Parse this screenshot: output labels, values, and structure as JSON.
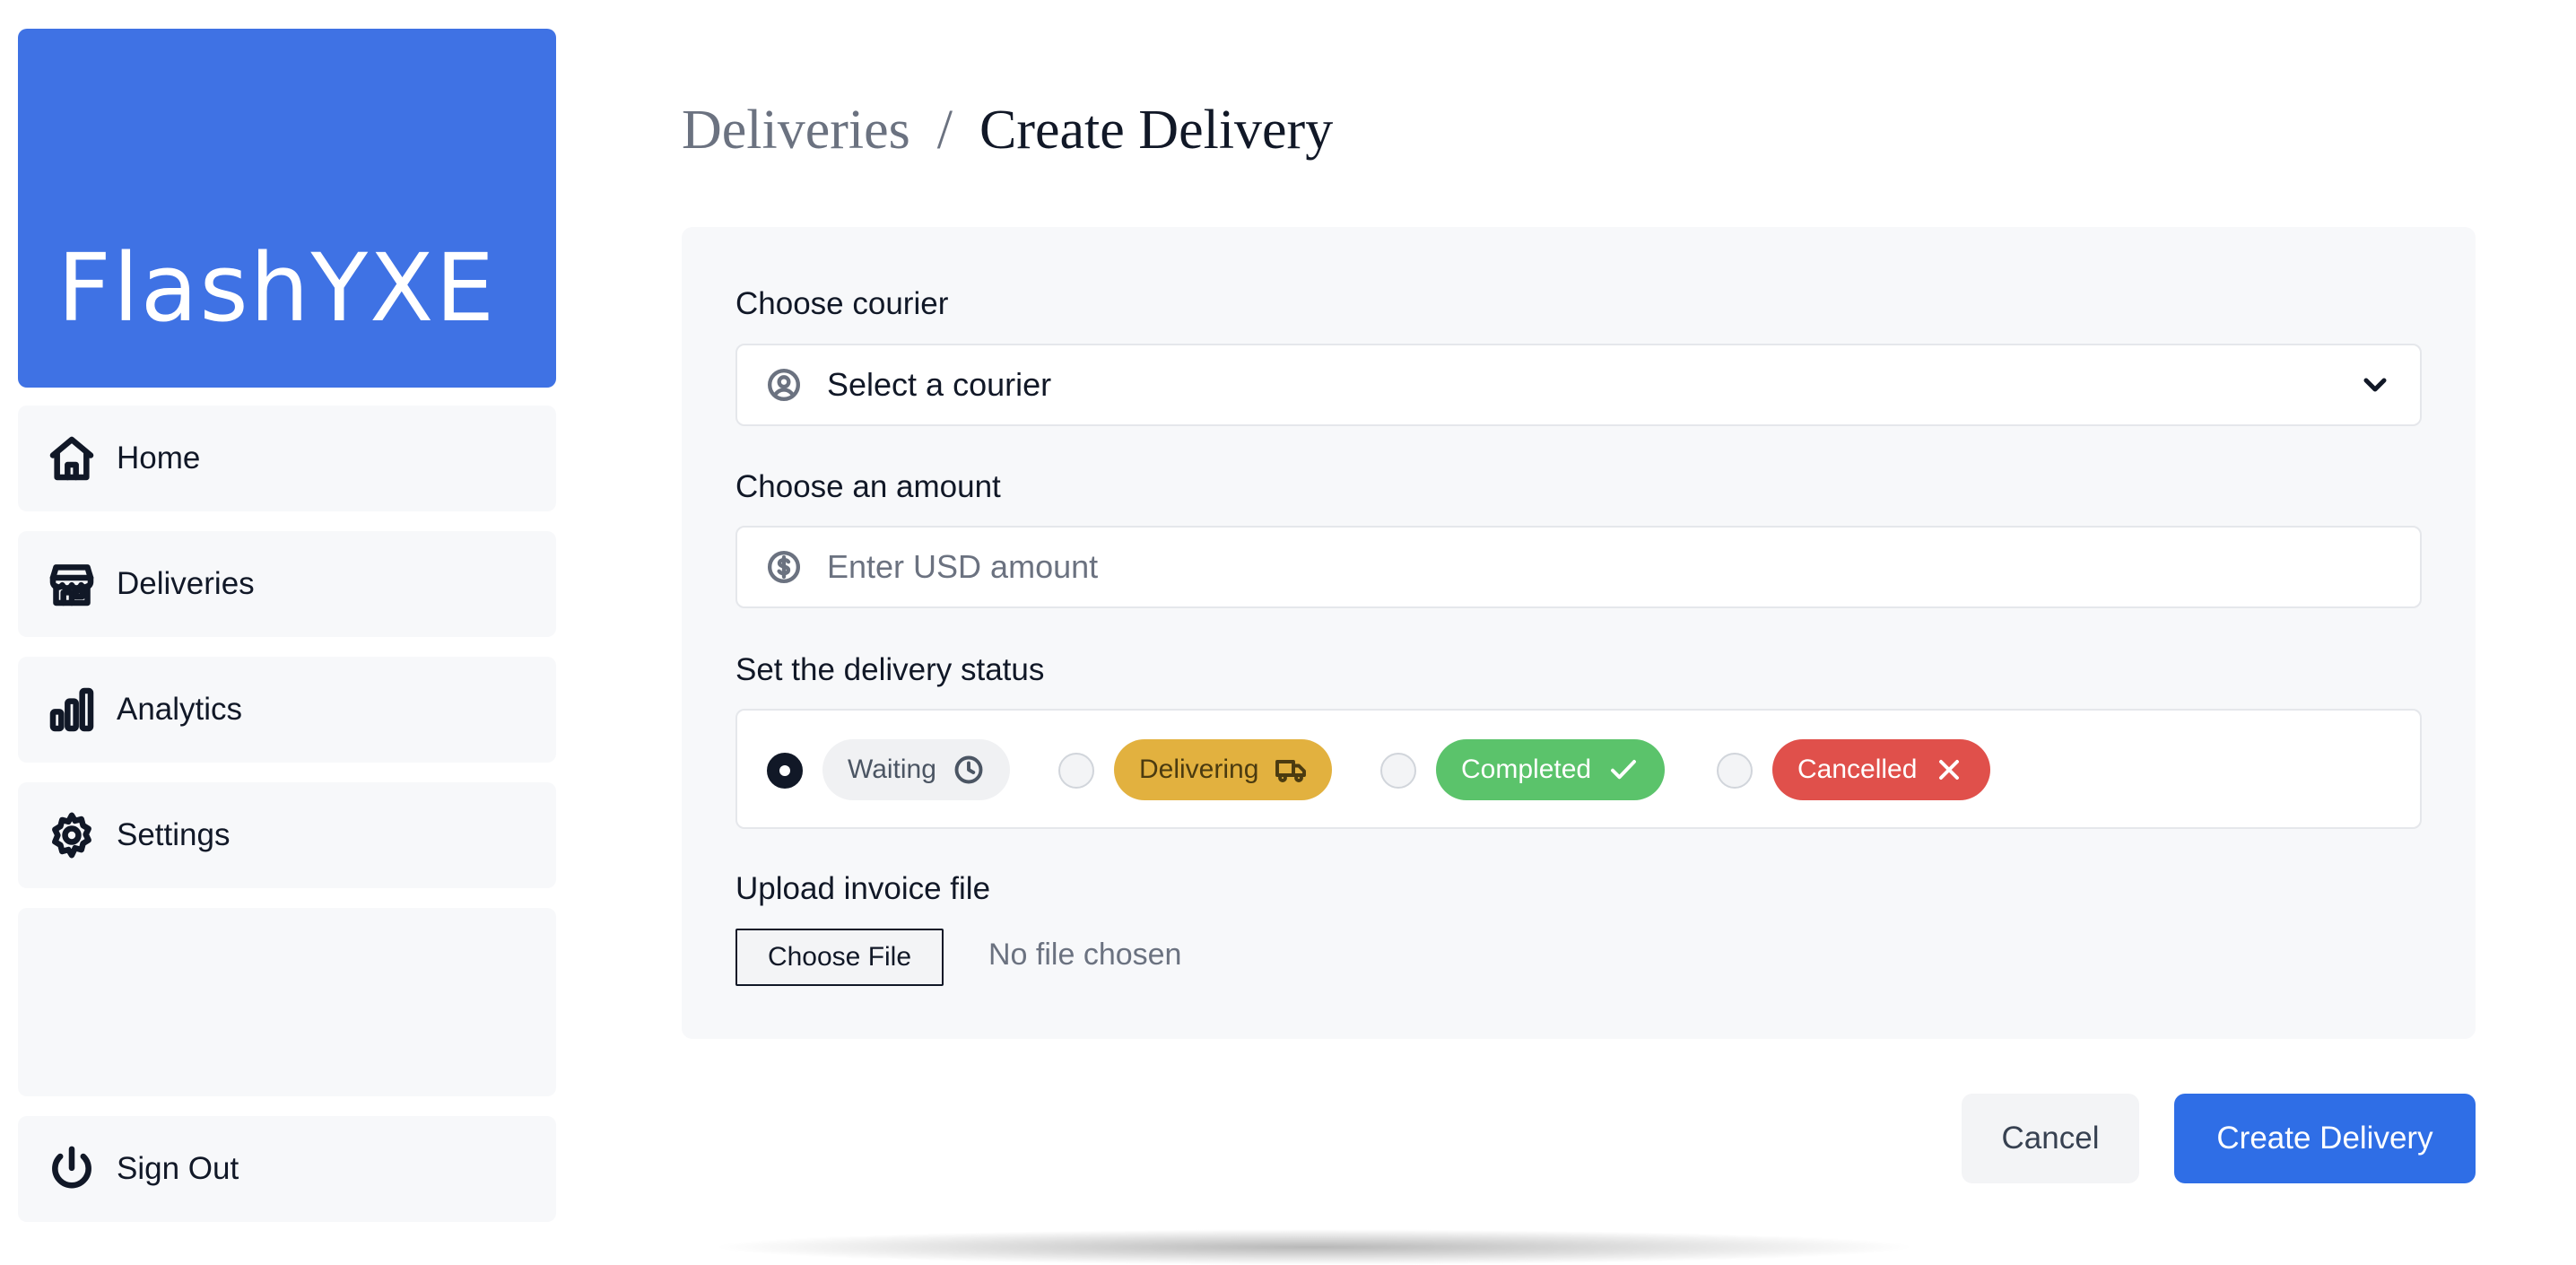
{
  "app": {
    "brand": "FlashYXE"
  },
  "sidebar": {
    "items": [
      {
        "label": "Home",
        "icon": "home-icon"
      },
      {
        "label": "Deliveries",
        "icon": "store-icon"
      },
      {
        "label": "Analytics",
        "icon": "bar-chart-icon"
      },
      {
        "label": "Settings",
        "icon": "gear-icon"
      }
    ],
    "sign_out": {
      "label": "Sign Out",
      "icon": "power-icon"
    }
  },
  "breadcrumb": {
    "parent": "Deliveries",
    "separator": "/",
    "current": "Create Delivery"
  },
  "form": {
    "courier": {
      "label": "Choose courier",
      "value": "Select a courier",
      "icon": "user-circle-icon"
    },
    "amount": {
      "label": "Choose an amount",
      "placeholder": "Enter USD amount",
      "icon": "dollar-circle-icon"
    },
    "status": {
      "label": "Set the delivery status",
      "selected": "Waiting",
      "options": [
        {
          "label": "Waiting",
          "icon": "clock-icon",
          "color": "#f0f1f3"
        },
        {
          "label": "Delivering",
          "icon": "truck-icon",
          "color": "#e2b13f"
        },
        {
          "label": "Completed",
          "icon": "check-icon",
          "color": "#5bc36b"
        },
        {
          "label": "Cancelled",
          "icon": "x-icon",
          "color": "#e0504b"
        }
      ]
    },
    "invoice": {
      "label": "Upload invoice file",
      "button": "Choose File",
      "status": "No file chosen"
    }
  },
  "actions": {
    "cancel": "Cancel",
    "create": "Create Delivery"
  },
  "colors": {
    "brand": "#3f72e4",
    "primary_button": "#2f6ee6"
  }
}
